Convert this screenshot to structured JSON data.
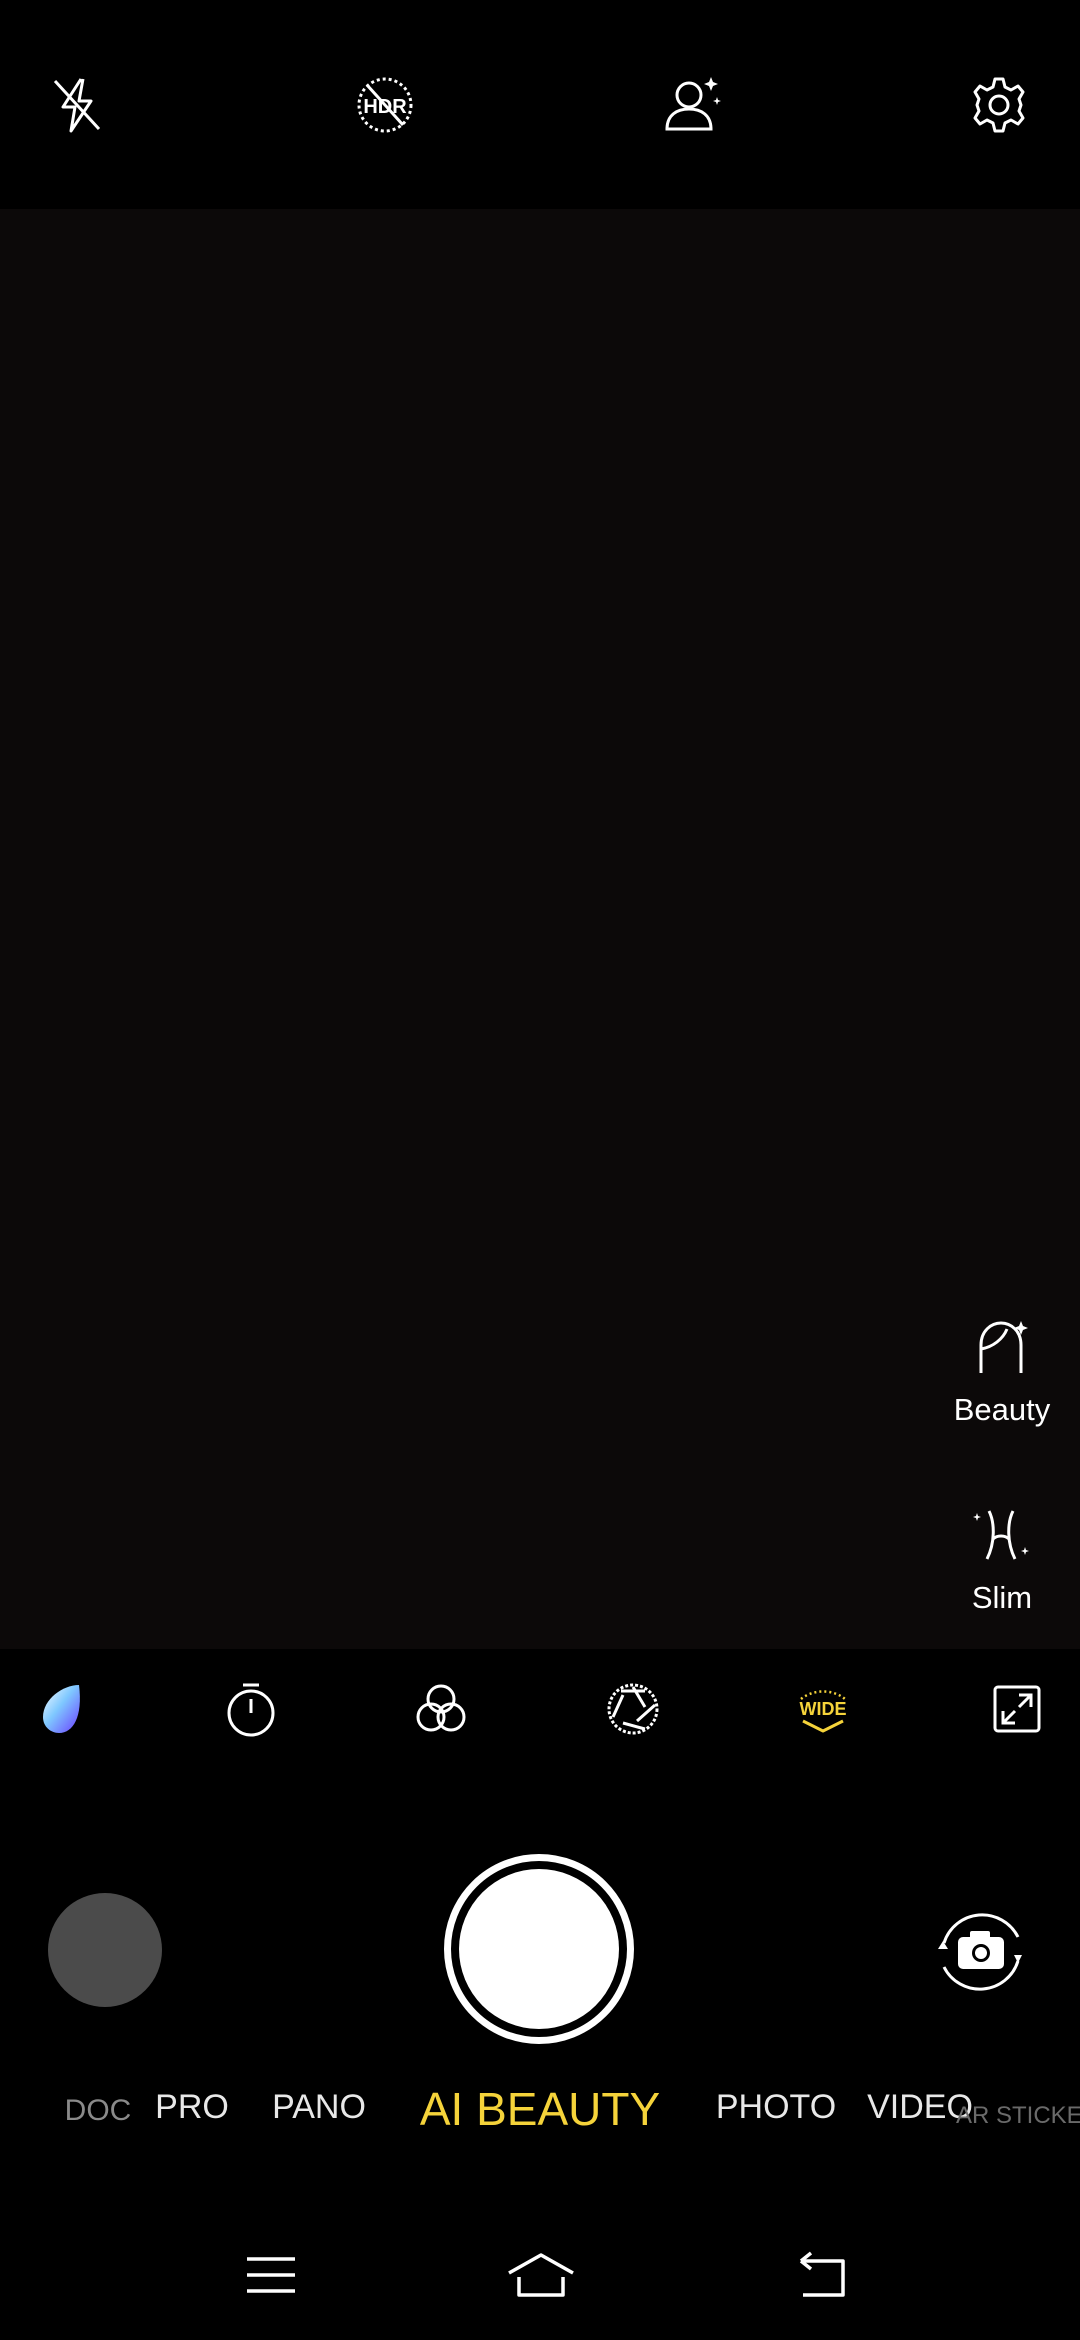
{
  "top_bar": {
    "icons": [
      "flash-off-icon",
      "hdr-off-icon",
      "face-beauty-icon",
      "settings-icon"
    ],
    "hdr_text": "HDR"
  },
  "side_tools": {
    "beauty_label": "Beauty",
    "slim_label": "Slim"
  },
  "tool_bar": {
    "icons": [
      "color-drop-icon",
      "timer-icon",
      "filters-icon",
      "aperture-icon",
      "wide-angle-icon",
      "expand-icon"
    ],
    "wide_text": "WIDE",
    "accent_color": "#f5d33a"
  },
  "modes": {
    "items": [
      "DOC",
      "PRO",
      "PANO",
      "AI BEAUTY",
      "PHOTO",
      "VIDEO",
      "AR STICKERS"
    ],
    "active": "AI BEAUTY",
    "active_color": "#f5d33a"
  },
  "nav_bar": {
    "icons": [
      "menu-icon",
      "home-icon",
      "back-icon"
    ]
  }
}
